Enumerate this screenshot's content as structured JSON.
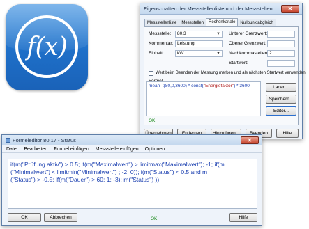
{
  "app_icon": {
    "label": "f(x)",
    "icon": "function-icon"
  },
  "properties_window": {
    "title": "Eigenschaften der Messstellenliste und der Messstellen",
    "tabs": [
      "Messstellenliste",
      "Messstellen",
      "Rechenkanale",
      "Nullpunktabgleich"
    ],
    "fields": {
      "messstelle_label": "Messstelle:",
      "messstelle_value": "80.3",
      "kommentar_label": "Kommentar:",
      "kommentar_value": "Leistung",
      "einheit_label": "Einheit:",
      "einheit_value": "kW",
      "unterer_label": "Unterer Grenzwert:",
      "unterer_value": "",
      "oberer_label": "Oberer Grenzwert:",
      "oberer_value": "",
      "nachkomma_label": "Nachkommastellen:",
      "nachkomma_value": "2",
      "startwert_label": "Startwert:",
      "startwert_value": ""
    },
    "checkbox_label": "Wert beim Beenden der Messung merken und als nächsten Startwert verwenden",
    "formula_label": "Formel",
    "formula_parts": {
      "a": "mean_t(80,0,3600) * const(",
      "b": "\"Energiefaktor\"",
      "c": ") * 3600"
    },
    "side_buttons": [
      "Laden...",
      "Speichern...",
      "Editor..."
    ],
    "status": "OK",
    "bottom_buttons": [
      "Übernehmen",
      "Entfernen",
      "Hinzufügen...",
      "Beenden",
      "Hilfe"
    ]
  },
  "editor_window": {
    "title": "Formeleditor 80.17 - Status",
    "menu": [
      "Datei",
      "Bearbeiten",
      "Formel einfügen",
      "Messstelle einfügen",
      "Optionen"
    ],
    "code_lines": [
      "if(m(\"Prüfung aktiv\") > 0.5; if(m(\"Maximalwert\") > limitmax(\"Maximalwert\"); -1; if(m",
      "(\"Minimalwert\") < limitmin(\"Minimalwert\") ; -2; 0));if(m(\"Status\") < 0.5 and m",
      "(\"Status\") > -0.5; if(m(\"Dauer\") > 60; 1; -3); m(\"Status\") ))"
    ],
    "buttons": {
      "ok": "OK",
      "cancel": "Abbrechen",
      "help": "Hilfe"
    },
    "status": "OK"
  }
}
